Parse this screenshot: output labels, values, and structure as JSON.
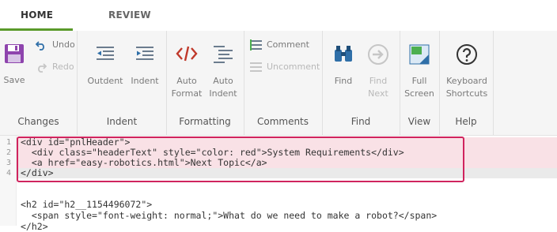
{
  "tabs": [
    {
      "label": "HOME",
      "active": true
    },
    {
      "label": "REVIEW",
      "active": false
    }
  ],
  "ribbon": {
    "groups": [
      {
        "label": "Changes"
      },
      {
        "label": "Indent"
      },
      {
        "label": "Formatting"
      },
      {
        "label": "Comments"
      },
      {
        "label": "Find"
      },
      {
        "label": "View"
      },
      {
        "label": "Help"
      }
    ],
    "buttons": {
      "save": "Save",
      "undo": "Undo",
      "redo": "Redo",
      "outdent": "Outdent",
      "indent": "Indent",
      "auto_format_1": "Auto",
      "auto_format_2": "Format",
      "auto_indent_1": "Auto",
      "auto_indent_2": "Indent",
      "comment": "Comment",
      "uncomment": "Uncomment",
      "find": "Find",
      "find_next_1": "Find",
      "find_next_2": "Next",
      "full_screen_1": "Full",
      "full_screen_2": "Screen",
      "shortcuts_1": "Keyboard",
      "shortcuts_2": "Shortcuts"
    },
    "colors": {
      "accent": "#5a9a2a",
      "save_icon": "#8e44ad",
      "format_icon": "#c0392b",
      "find_icon": "#2f6fa8"
    }
  },
  "editor": {
    "lines": [
      {
        "num": "1",
        "text": "<div id=\"pnlHeader\">"
      },
      {
        "num": "2",
        "text": "  <div class=\"headerText\" style=\"color: red\">System Requirements</div>"
      },
      {
        "num": "3",
        "text": "  <a href=\"easy-robotics.html\">Next Topic</a>"
      },
      {
        "num": "4",
        "text": "</div>"
      },
      {
        "num": "",
        "text": ""
      },
      {
        "num": "",
        "text": ""
      },
      {
        "num": "",
        "text": "<h2 id=\"h2__1154496072\">"
      },
      {
        "num": "",
        "text": "  <span style=\"font-weight: normal;\">What do we need to make a robot?</span>"
      },
      {
        "num": "",
        "text": "</h2>"
      }
    ],
    "selection_color": "#d0245e"
  }
}
